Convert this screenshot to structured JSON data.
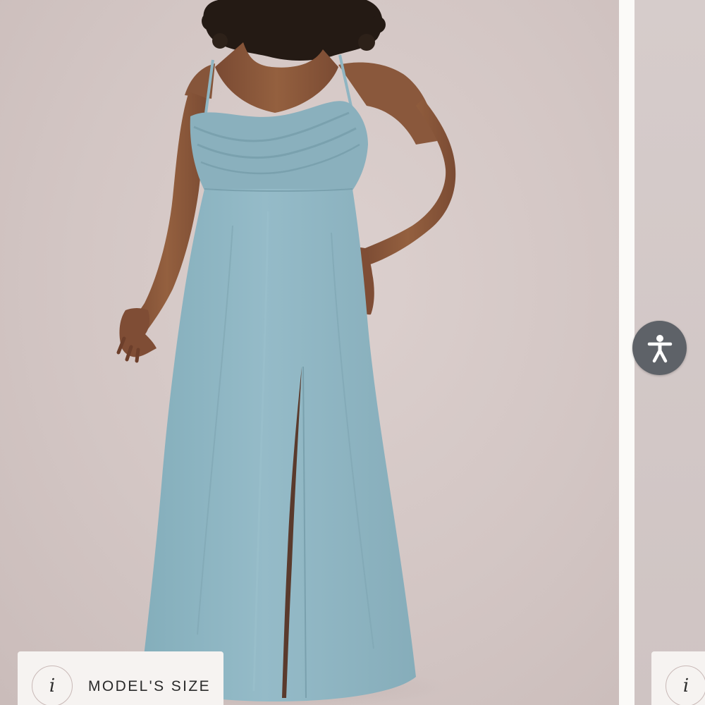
{
  "gallery": {
    "main_slide": {
      "image_alt": "",
      "model_size": {
        "info_glyph": "i",
        "label": "MODEL'S SIZE"
      }
    },
    "next_slide": {
      "model_size": {
        "info_glyph": "i"
      }
    }
  },
  "accessibility": {
    "icon": "accessibility-person-icon"
  },
  "colors": {
    "background": "#d3c6c4",
    "dress": "#8fb5c2",
    "badge_background": "#f6f3f1",
    "accessibility_button": "#5e6268",
    "gutter": "#fbfaf8"
  }
}
